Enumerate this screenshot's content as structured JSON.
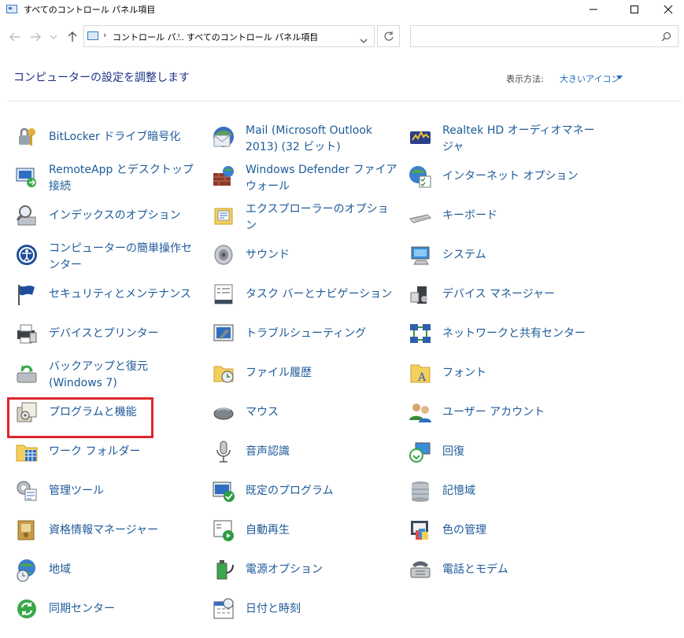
{
  "window": {
    "title": "すべてのコントロール パネル項目",
    "minimize_glyph": "—",
    "maximize_glyph": "☐",
    "close_glyph": "✕"
  },
  "nav": {
    "back_icon": "back-arrow-icon",
    "forward_icon": "forward-arrow-icon",
    "up_icon": "up-arrow-icon",
    "breadcrumb": [
      "コントロール パ...",
      "すべてのコントロール パネル項目"
    ],
    "search_placeholder": ""
  },
  "header": {
    "title": "コンピューターの設定を調整します",
    "view_by_label": "表示方法:",
    "view_by_value": "大きいアイコン"
  },
  "colors": {
    "link": "#1e5a99",
    "heading": "#1e3287",
    "highlight": "#e0262c"
  },
  "items": [
    {
      "label": "BitLocker ドライブ暗号化",
      "icon": "bitlocker-key-icon"
    },
    {
      "label": "Mail (Microsoft Outlook 2013) (32 ビット)",
      "icon": "mail-icon"
    },
    {
      "label": "Realtek HD オーディオマネージャ",
      "icon": "realtek-audio-icon"
    },
    {
      "label": "RemoteApp とデスクトップ接続",
      "icon": "remoteapp-icon"
    },
    {
      "label": "Windows Defender ファイアウォール",
      "icon": "firewall-icon"
    },
    {
      "label": "インターネット オプション",
      "icon": "internet-options-icon"
    },
    {
      "label": "インデックスのオプション",
      "icon": "indexing-icon"
    },
    {
      "label": "エクスプローラーのオプション",
      "icon": "explorer-options-icon"
    },
    {
      "label": "キーボード",
      "icon": "keyboard-icon"
    },
    {
      "label": "コンピューターの簡単操作センター",
      "icon": "ease-of-access-icon"
    },
    {
      "label": "サウンド",
      "icon": "sound-icon"
    },
    {
      "label": "システム",
      "icon": "system-icon"
    },
    {
      "label": "セキュリティとメンテナンス",
      "icon": "security-flag-icon"
    },
    {
      "label": "タスク バーとナビゲーション",
      "icon": "taskbar-icon"
    },
    {
      "label": "デバイス マネージャー",
      "icon": "device-manager-icon"
    },
    {
      "label": "デバイスとプリンター",
      "icon": "printer-icon"
    },
    {
      "label": "トラブルシューティング",
      "icon": "troubleshooting-icon"
    },
    {
      "label": "ネットワークと共有センター",
      "icon": "network-icon"
    },
    {
      "label": "バックアップと復元 (Windows 7)",
      "icon": "backup-icon"
    },
    {
      "label": "ファイル履歴",
      "icon": "file-history-icon"
    },
    {
      "label": "フォント",
      "icon": "fonts-icon"
    },
    {
      "label": "プログラムと機能",
      "icon": "programs-features-icon"
    },
    {
      "label": "マウス",
      "icon": "mouse-icon"
    },
    {
      "label": "ユーザー アカウント",
      "icon": "user-accounts-icon"
    },
    {
      "label": "ワーク フォルダー",
      "icon": "work-folders-icon"
    },
    {
      "label": "音声認識",
      "icon": "microphone-icon"
    },
    {
      "label": "回復",
      "icon": "recovery-icon"
    },
    {
      "label": "管理ツール",
      "icon": "admin-tools-icon"
    },
    {
      "label": "既定のプログラム",
      "icon": "default-programs-icon"
    },
    {
      "label": "記憶域",
      "icon": "storage-spaces-icon"
    },
    {
      "label": "資格情報マネージャー",
      "icon": "credential-manager-icon"
    },
    {
      "label": "自動再生",
      "icon": "autoplay-icon"
    },
    {
      "label": "色の管理",
      "icon": "color-management-icon"
    },
    {
      "label": "地域",
      "icon": "region-globe-icon"
    },
    {
      "label": "電源オプション",
      "icon": "power-options-icon"
    },
    {
      "label": "電話とモデム",
      "icon": "phone-modem-icon"
    },
    {
      "label": "同期センター",
      "icon": "sync-center-icon"
    },
    {
      "label": "日付と時刻",
      "icon": "date-time-icon"
    }
  ]
}
